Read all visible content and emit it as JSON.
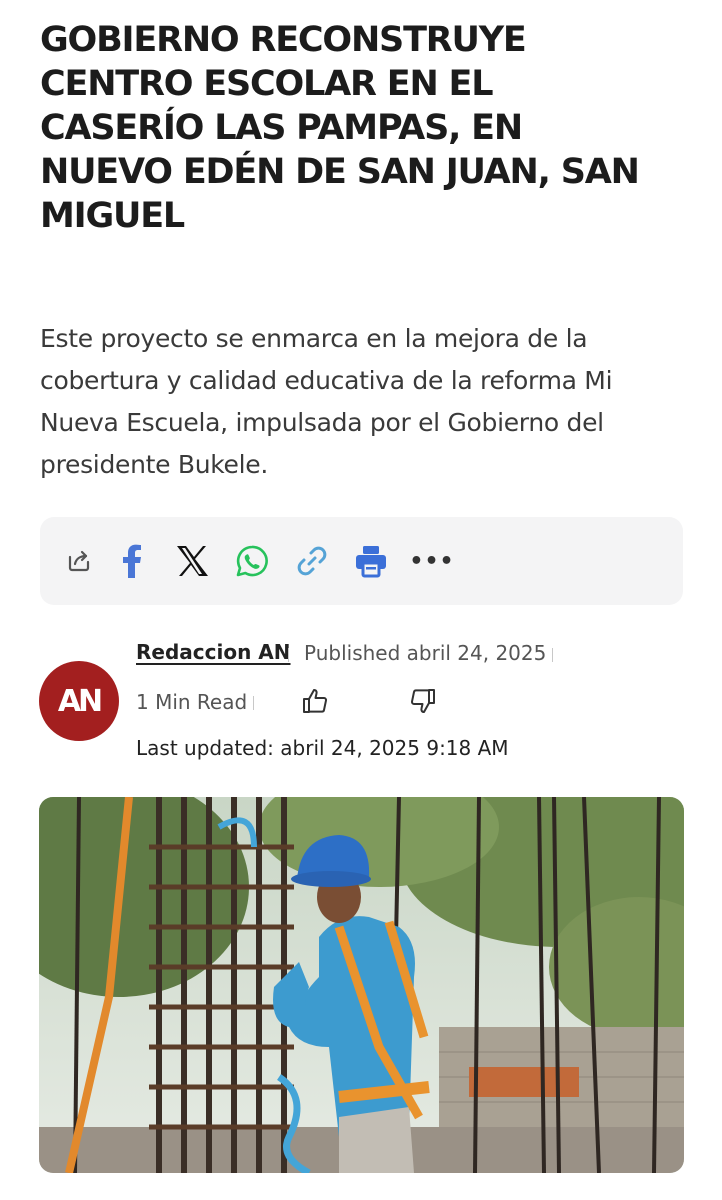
{
  "article": {
    "headline_lines": [
      "GOBIERNO RECONSTRUYE",
      "CENTRO ESCOLAR EN EL",
      "CASERÍO LAS PAMPAS, EN",
      "NUEVO EDÉN DE SAN JUAN, SAN",
      "MIGUEL"
    ],
    "summary_lines": [
      "Este proyecto se enmarca en la mejora de la",
      "cobertura y calidad educativa de la reforma Mi",
      "Nueva Escuela, impulsada por el Gobierno del",
      "presidente Bukele."
    ]
  },
  "share": {
    "icons": [
      "share-icon",
      "facebook-icon",
      "x-icon",
      "whatsapp-icon",
      "link-icon",
      "print-icon",
      "more-icon"
    ],
    "colors": {
      "facebook": "#4a76d6",
      "x": "#111111",
      "whatsapp": "#27c25c",
      "link": "#55a3d6",
      "print": "#3b6fd8"
    },
    "more_label": "•••"
  },
  "author": {
    "avatar_text": "AN",
    "avatar_color": "#a31f1f",
    "name": "Redaccion AN",
    "published": "Published abril 24, 2025",
    "read_time": "1 Min Read",
    "last_updated": "Last updated: abril 24, 2025 9:18 AM"
  },
  "media": {
    "image_icon": "construction-worker-photo"
  }
}
